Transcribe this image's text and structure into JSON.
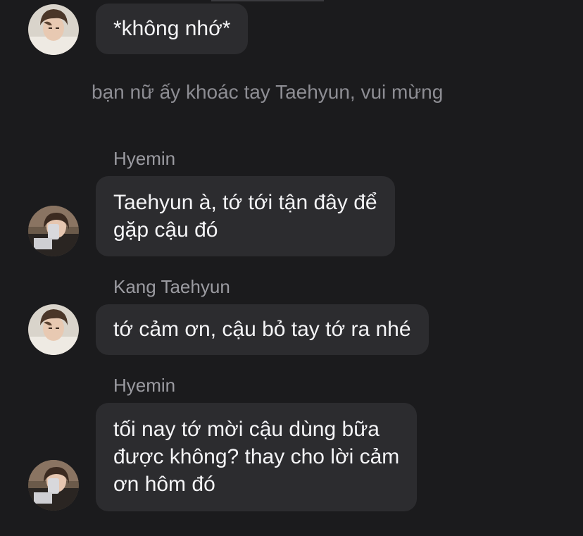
{
  "colors": {
    "background": "#1b1b1d",
    "bubble": "#2c2c2f",
    "sender_name": "#9b9ba1",
    "system_text": "#8d8d93",
    "message_text": "#f4f4f6"
  },
  "messages": [
    {
      "type": "message",
      "sender": "",
      "avatar": "taehyun-avatar",
      "lines": [
        "*không nhớ*"
      ]
    },
    {
      "type": "system",
      "text": "bạn nữ ấy khoác tay Taehyun, vui mừng"
    },
    {
      "type": "message",
      "sender": "Hyemin",
      "avatar": "hyemin-avatar",
      "lines": [
        "Taehyun à, tớ tới tận đây để",
        "gặp cậu đó"
      ]
    },
    {
      "type": "message",
      "sender": "Kang Taehyun",
      "avatar": "taehyun-avatar",
      "lines": [
        "tớ cảm ơn, cậu bỏ tay tớ ra nhé"
      ]
    },
    {
      "type": "message",
      "sender": "Hyemin",
      "avatar": "hyemin-avatar",
      "lines": [
        "tối nay tớ mời cậu dùng bữa",
        "được không? thay cho lời cảm",
        "ơn hôm đó"
      ]
    }
  ]
}
